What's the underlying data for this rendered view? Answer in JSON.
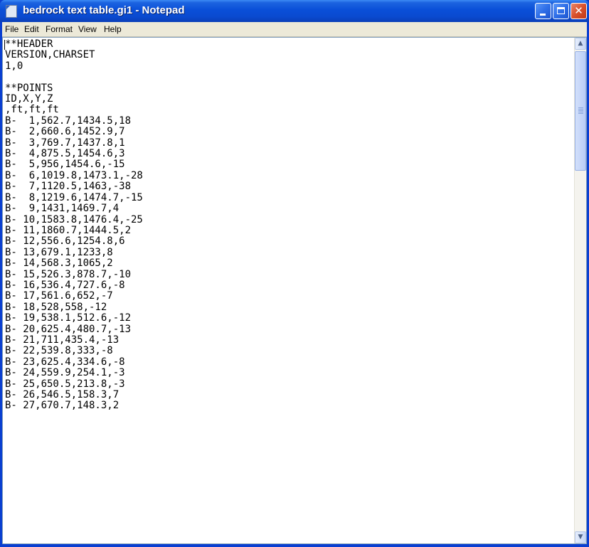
{
  "window": {
    "title": "bedrock text table.gi1 - Notepad",
    "icon": "notepad-icon"
  },
  "menu": {
    "file": "File",
    "edit": "Edit",
    "format": "Format",
    "view": "View",
    "help": "Help"
  },
  "editor": {
    "content": "**HEADER\nVERSION,CHARSET\n1,0\n\n**POINTS\nID,X,Y,Z\n,ft,ft,ft\nB-  1,562.7,1434.5,18\nB-  2,660.6,1452.9,7\nB-  3,769.7,1437.8,1\nB-  4,875.5,1454.6,3\nB-  5,956,1454.6,-15\nB-  6,1019.8,1473.1,-28\nB-  7,1120.5,1463,-38\nB-  8,1219.6,1474.7,-15\nB-  9,1431,1469.7,4\nB- 10,1583.8,1476.4,-25\nB- 11,1860.7,1444.5,2\nB- 12,556.6,1254.8,6\nB- 13,679.1,1233,8\nB- 14,568.3,1065,2\nB- 15,526.3,878.7,-10\nB- 16,536.4,727.6,-8\nB- 17,561.6,652,-7\nB- 18,528,558,-12\nB- 19,538.1,512.6,-12\nB- 20,625.4,480.7,-13\nB- 21,711,435.4,-13\nB- 22,539.8,333,-8\nB- 23,625.4,334.6,-8\nB- 24,559.9,254.1,-3\nB- 25,650.5,213.8,-3\nB- 26,546.5,158.3,7\nB- 27,670.7,148.3,2"
  },
  "colors": {
    "titlebar": "#0a4fd8",
    "menubar": "#ece9d8",
    "close_button": "#d9512c"
  }
}
